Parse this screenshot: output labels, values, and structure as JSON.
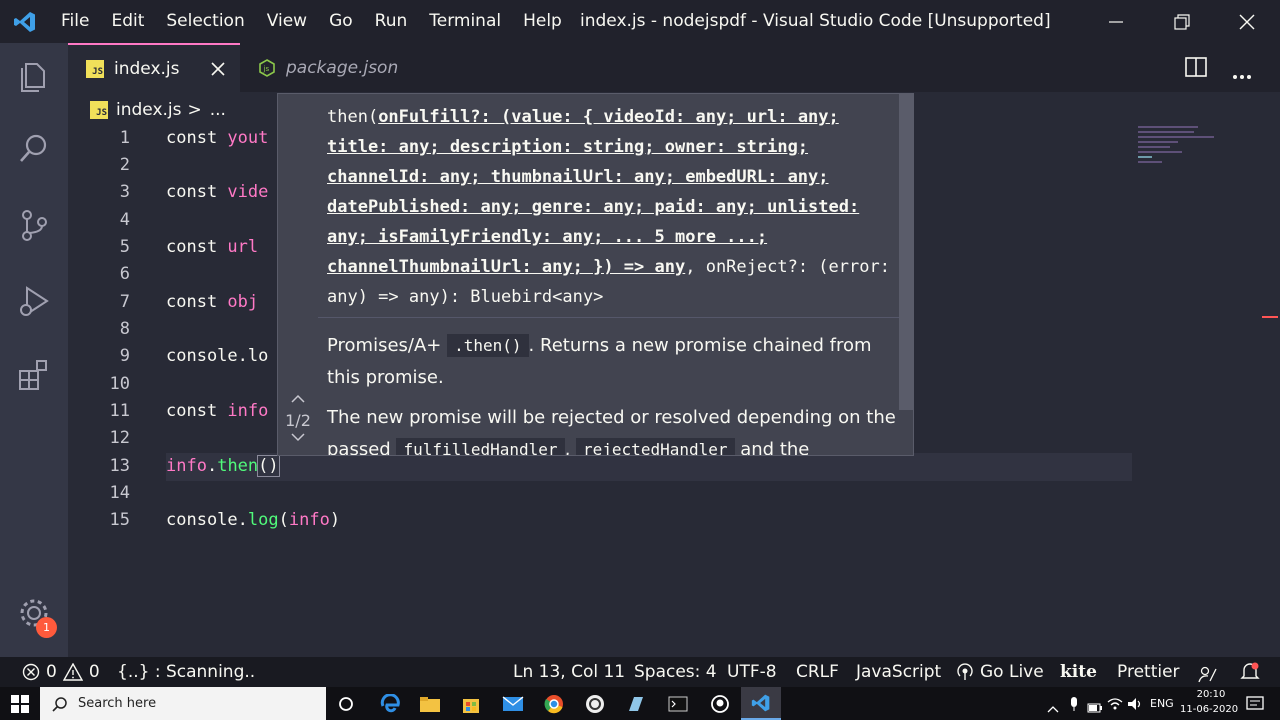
{
  "window": {
    "title": "index.js - nodejspdf - Visual Studio Code [Unsupported]",
    "menu": [
      "File",
      "Edit",
      "Selection",
      "View",
      "Go",
      "Run",
      "Terminal",
      "Help"
    ]
  },
  "tabs": [
    {
      "label": "index.js",
      "active": true,
      "badge": "JS"
    },
    {
      "label": "package.json",
      "active": false
    }
  ],
  "breadcrumb": {
    "file": "index.js",
    "separator": ">",
    "more": "..."
  },
  "editor": {
    "line_numbers": [
      "1",
      "2",
      "3",
      "4",
      "5",
      "6",
      "7",
      "8",
      "9",
      "10",
      "11",
      "12",
      "13",
      "14",
      "15"
    ],
    "lines": {
      "l1_kw": "const",
      "l1_rest": " yout",
      "l3_kw": "const",
      "l3_rest": " vide",
      "l5_kw": "const",
      "l5_rest": " url",
      "l7_kw": "const",
      "l7_rest": " obj",
      "l9_a": "console",
      "l9_b": ".lo",
      "l11_kw": "const",
      "l11_rest": " info",
      "l13_a": "info",
      "l13_b": ".",
      "l13_c": "then",
      "l13_d": "()",
      "l15_a": "console",
      "l15_b": ".",
      "l15_c": "log",
      "l15_d": "(",
      "l15_e": "info",
      "l15_f": ")"
    }
  },
  "hover": {
    "sig_prefix": "then(",
    "sig_active": "onFulfill?: (value: { videoId: any; url: any; title: any; description: string; owner: string; channelId: any; thumbnailUrl: any; embedURL: any; datePublished: any; genre: any; paid: any; unlisted: any; isFamilyFriendly: any; ... 5 more ...; channelThumbnailUrl: any; }) => any",
    "sig_suffix": ", onReject?: (error: any) => any): Bluebird<any>",
    "doc1_a": "Promises/A+ ",
    "doc1_code": ".then()",
    "doc1_b": ". Returns a new promise chained from this promise.",
    "doc2_a": "The new promise will be rejected or resolved depending on the passed ",
    "doc2_code1": "fulfilledHandler",
    "doc2_b": ", ",
    "doc2_code2": "rejectedHandler",
    "doc2_c": " and the",
    "pager": "1/2"
  },
  "statusbar": {
    "errors": "0",
    "warnings": "0",
    "scanning": "{..} : Scanning..",
    "position": "Ln 13, Col 11",
    "spaces": "Spaces: 4",
    "encoding": "UTF-8",
    "eol": "CRLF",
    "language": "JavaScript",
    "golive": "Go Live",
    "kite": "kite",
    "prettier": "Prettier"
  },
  "taskbar": {
    "search_placeholder": "Search here",
    "lang": "ENG",
    "time": "20:10",
    "date": "11-06-2020"
  },
  "badges": {
    "settings_count": "1"
  },
  "colors": {
    "accent_pink": "#ff79c6",
    "function_green": "#50fa7b",
    "bg": "#282a36"
  }
}
